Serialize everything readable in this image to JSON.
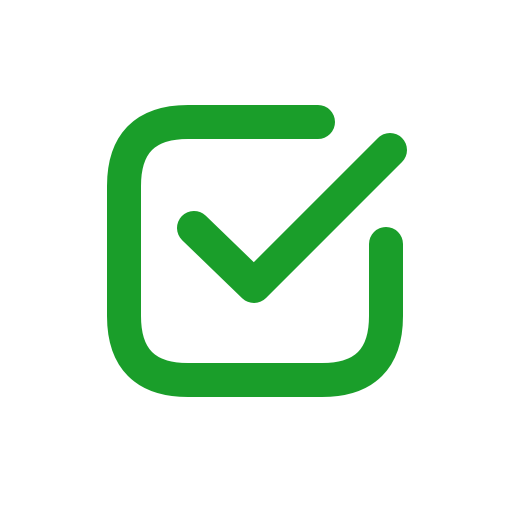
{
  "icon": {
    "name": "checkbox-checked-icon",
    "state": "checked",
    "colors": {
      "stroke": "#1a9e2a",
      "background": "#ffffff"
    }
  }
}
